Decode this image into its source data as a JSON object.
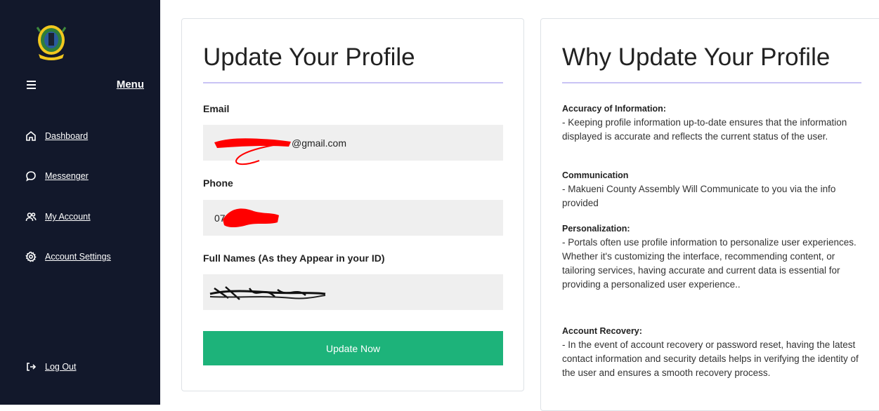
{
  "sidebar": {
    "menu_label": "Menu",
    "items": [
      {
        "label": "Dashboard",
        "icon": "home-icon"
      },
      {
        "label": "Messenger",
        "icon": "chat-icon"
      },
      {
        "label": "My Account",
        "icon": "users-icon"
      },
      {
        "label": "Account Settings",
        "icon": "gear-icon"
      }
    ],
    "logout_label": "Log Out"
  },
  "profile_form": {
    "title": "Update Your Profile",
    "email_label": "Email",
    "email_value_visible": "@gmail.com",
    "phone_label": "Phone",
    "phone_value_visible": "07",
    "fullname_label": "Full Names (As they Appear in your ID)",
    "submit_label": "Update Now"
  },
  "why_panel": {
    "title": "Why Update Your Profile",
    "reasons": [
      {
        "heading": "Accuracy of Information:",
        "body": "- Keeping profile information up-to-date ensures that the information displayed is accurate and reflects the current status of the user."
      },
      {
        "heading": "Communication",
        "body": "- Makueni County Assembly Will Communicate to you via the info provided"
      },
      {
        "heading": "Personalization:",
        "body": "- Portals often use profile information to personalize user experiences. Whether it's customizing the interface, recommending content, or tailoring services, having accurate and current data is essential for providing a personalized user experience.."
      },
      {
        "heading": "Account Recovery:",
        "body": "- In the event of account recovery or password reset, having the latest contact information and security details helps in verifying the identity of the user and ensures a smooth recovery process."
      }
    ]
  },
  "colors": {
    "sidebar_bg": "#12182b",
    "accent_green": "#1db37a",
    "title_rule": "#c9c3f5",
    "redaction": "#ff0000"
  }
}
